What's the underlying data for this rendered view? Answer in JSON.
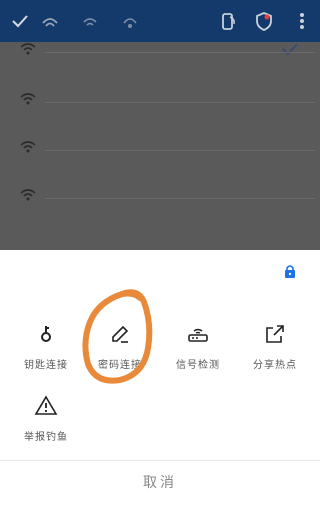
{
  "colors": {
    "accent": "#1a73e8",
    "annotation": "#e88a3a",
    "dim_overlay": "#5a5a5a"
  },
  "sheet": {
    "options": [
      {
        "label": "钥匙连接",
        "icon": "key-icon"
      },
      {
        "label": "密码连接",
        "icon": "pencil-icon"
      },
      {
        "label": "信号检测",
        "icon": "router-icon"
      },
      {
        "label": "分享热点",
        "icon": "share-icon"
      },
      {
        "label": "举报钓鱼",
        "icon": "warning-icon"
      }
    ],
    "cancel_label": "取消",
    "lock_icon": "lock-icon"
  }
}
